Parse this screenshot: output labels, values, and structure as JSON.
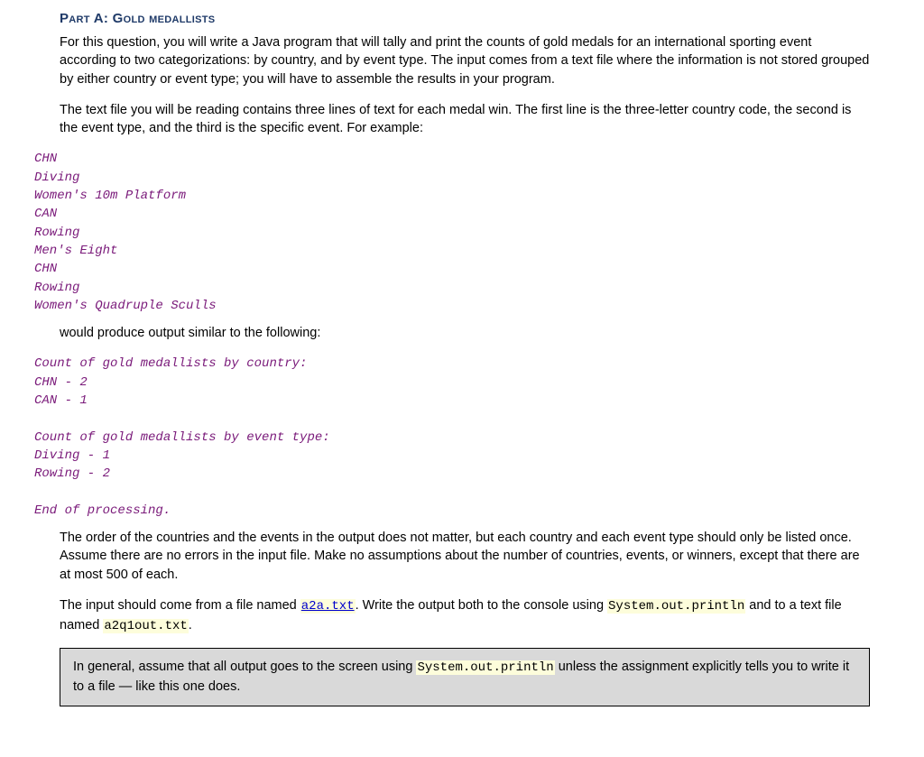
{
  "heading": "Part A: Gold medallists",
  "para1": "For this question, you will write a Java program that will tally and print the counts of gold medals for an international sporting event according to two categorizations: by country, and by event type. The input comes from a text file where the information is not stored grouped by either country or event type; you will have to assemble the results in your program.",
  "para2": "The text file you will be reading contains three lines of text for each medal win. The first line is the three-letter country code, the second is the event type, and the third is the specific event. For example:",
  "code1": "CHN\nDiving\nWomen's 10m Platform\nCAN\nRowing\nMen's Eight\nCHN\nRowing\nWomen's Quadruple Sculls",
  "para3": "would produce output similar to the following:",
  "code2": "Count of gold medallists by country:\nCHN - 2\nCAN - 1\n\nCount of gold medallists by event type:\nDiving - 1\nRowing - 2\n\nEnd of processing.",
  "para4": "The order of the countries and the events in the output does not matter, but each country and each event type should only be listed once. Assume there are no errors in the input file. Make no assumptions about the number of countries, events, or winners, except that there are at most 500 of each.",
  "para5_part1": "The input should come from a file named ",
  "para5_link": "a2a.txt",
  "para5_part2": ". Write the output both to the console using ",
  "para5_code1": "System.out.println",
  "para5_part3": " and to a text file named ",
  "para5_code2": "a2q1out.txt",
  "para5_part4": ".",
  "note_part1": "In general, assume that all output goes to the screen using ",
  "note_code": "System.out.println",
  "note_part2": " unless the assignment explicitly tells you to write it to a file — like this one does."
}
